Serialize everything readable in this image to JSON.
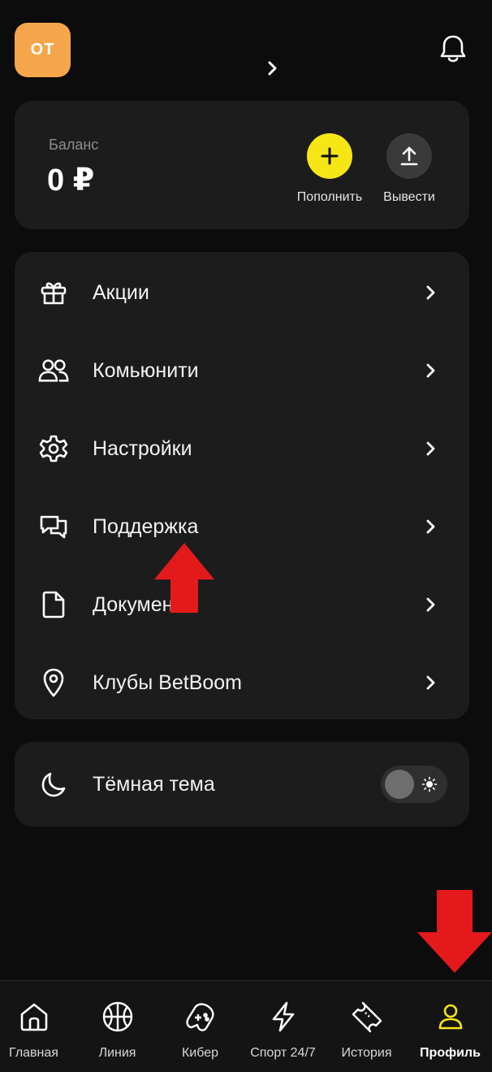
{
  "header": {
    "avatar_initials": "ОТ",
    "avatar_color": "#f5a64a",
    "profile_chevron_icon": "chevron-right-icon",
    "bell_icon": "bell-icon"
  },
  "balance": {
    "label": "Баланс",
    "value": "0 ₽",
    "deposit": {
      "label": "Пополнить",
      "icon": "plus-icon",
      "color": "#f7e616"
    },
    "withdraw": {
      "label": "Вывести",
      "icon": "upload-icon"
    }
  },
  "menu": {
    "items": [
      {
        "label": "Акции",
        "icon": "gift-icon"
      },
      {
        "label": "Комьюнити",
        "icon": "users-icon"
      },
      {
        "label": "Настройки",
        "icon": "gear-icon"
      },
      {
        "label": "Поддержка",
        "icon": "chat-icon"
      },
      {
        "label": "Документы",
        "icon": "document-icon"
      },
      {
        "label": "Клубы BetBoom",
        "icon": "map-pin-icon"
      }
    ]
  },
  "theme": {
    "label": "Тёмная тема",
    "icon": "moon-icon",
    "toggle_on": false
  },
  "tabbar": {
    "tabs": [
      {
        "label": "Главная",
        "icon": "home-icon"
      },
      {
        "label": "Линия",
        "icon": "basketball-icon"
      },
      {
        "label": "Кибер",
        "icon": "gamepad-icon"
      },
      {
        "label": "Спорт 24/7",
        "icon": "lightning-icon"
      },
      {
        "label": "История",
        "icon": "ticket-icon"
      },
      {
        "label": "Профиль",
        "icon": "user-icon",
        "active": true,
        "active_color": "#f7e616"
      }
    ]
  },
  "annotations": {
    "arrow_color": "#e3191c"
  }
}
